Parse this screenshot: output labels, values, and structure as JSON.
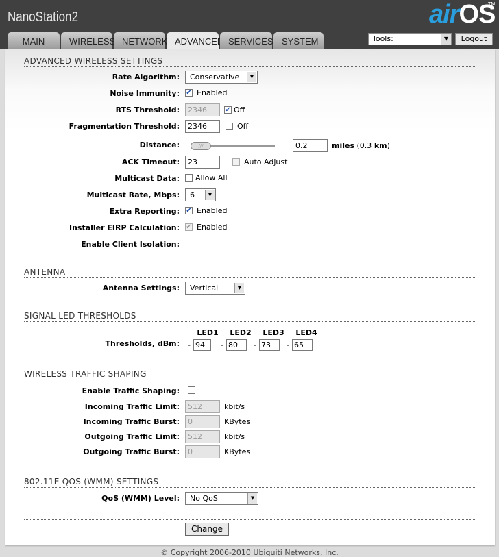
{
  "header": {
    "device_name": "NanoStation2",
    "logo": "airOS",
    "tm": "TM",
    "tools_label": "Tools:",
    "logout": "Logout"
  },
  "tabs": [
    "MAIN",
    "WIRELESS",
    "NETWORK",
    "ADVANCED",
    "SERVICES",
    "SYSTEM"
  ],
  "active_tab": "ADVANCED",
  "advanced": {
    "title": "ADVANCED WIRELESS SETTINGS",
    "rate_algorithm": {
      "label": "Rate Algorithm:",
      "value": "Conservative"
    },
    "noise_immunity": {
      "label": "Noise Immunity:",
      "checked": true,
      "text": "Enabled"
    },
    "rts": {
      "label": "RTS Threshold:",
      "value": "2346",
      "off_checked": true,
      "off_text": "Off"
    },
    "frag": {
      "label": "Fragmentation Threshold:",
      "value": "2346",
      "off_checked": false,
      "off_text": "Off"
    },
    "distance": {
      "label": "Distance:",
      "value": "0.2",
      "unit": "miles",
      "km_open": "(0.3 ",
      "km": "km",
      ")": ")",
      "km_close": ")"
    },
    "ack": {
      "label": "ACK Timeout:",
      "value": "23",
      "auto_text": "Auto Adjust"
    },
    "multicast": {
      "label": "Multicast Data:",
      "text": "Allow All"
    },
    "multicast_rate": {
      "label": "Multicast Rate, Mbps:",
      "value": "6"
    },
    "extra_reporting": {
      "label": "Extra Reporting:",
      "text": "Enabled"
    },
    "eirp": {
      "label": "Installer EIRP Calculation:",
      "text": "Enabled"
    },
    "client_isolation": {
      "label": "Enable Client Isolation:"
    }
  },
  "antenna": {
    "title": "ANTENNA",
    "label": "Antenna Settings:",
    "value": "Vertical"
  },
  "led": {
    "title": "SIGNAL LED THRESHOLDS",
    "label": "Thresholds, dBm:",
    "dash": "-",
    "leds": [
      {
        "name": "LED1",
        "value": "94"
      },
      {
        "name": "LED2",
        "value": "80"
      },
      {
        "name": "LED3",
        "value": "73"
      },
      {
        "name": "LED4",
        "value": "65"
      }
    ]
  },
  "shaping": {
    "title": "WIRELESS TRAFFIC SHAPING",
    "enable_label": "Enable Traffic Shaping:",
    "rows": [
      {
        "label": "Incoming Traffic Limit:",
        "value": "512",
        "unit": "kbit/s"
      },
      {
        "label": "Incoming Traffic Burst:",
        "value": "0",
        "unit": "KBytes"
      },
      {
        "label": "Outgoing Traffic Limit:",
        "value": "512",
        "unit": "kbit/s"
      },
      {
        "label": "Outgoing Traffic Burst:",
        "value": "0",
        "unit": "KBytes"
      }
    ]
  },
  "qos": {
    "title": "802.11E QOS (WMM) SETTINGS",
    "label": "QoS (WMM) Level:",
    "value": "No QoS"
  },
  "change": "Change",
  "footer": "© Copyright 2006-2010 Ubiquiti Networks, Inc."
}
